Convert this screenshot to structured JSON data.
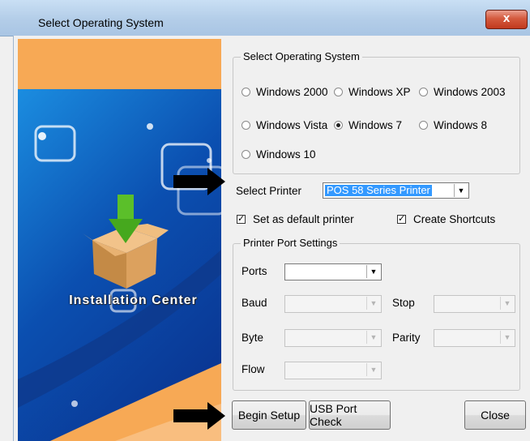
{
  "window": {
    "title": "Select Operating System",
    "close_glyph": "x"
  },
  "banner": {
    "label": "Installation Center"
  },
  "os_group": {
    "legend": "Select Operating System",
    "options": [
      {
        "label": "Windows 2000",
        "selected": false
      },
      {
        "label": "Windows XP",
        "selected": false
      },
      {
        "label": "Windows 2003",
        "selected": false
      },
      {
        "label": "Windows Vista",
        "selected": false
      },
      {
        "label": "Windows 7",
        "selected": true
      },
      {
        "label": "Windows 8",
        "selected": false
      },
      {
        "label": "Windows 10",
        "selected": false
      }
    ]
  },
  "printer": {
    "label": "Select Printer",
    "value": "POS 58 Series Printer",
    "default_label": "Set as default printer",
    "default_checked": true,
    "shortcuts_label": "Create Shortcuts",
    "shortcuts_checked": true
  },
  "port_group": {
    "legend": "Printer Port Settings",
    "ports_label": "Ports",
    "baud_label": "Baud",
    "stop_label": "Stop",
    "byte_label": "Byte",
    "parity_label": "Parity",
    "flow_label": "Flow"
  },
  "buttons": {
    "begin_setup": "Begin Setup",
    "usb_port_check": "USB Port Check",
    "close": "Close"
  },
  "check_glyph": "✓",
  "dropdown_glyph": "▼"
}
